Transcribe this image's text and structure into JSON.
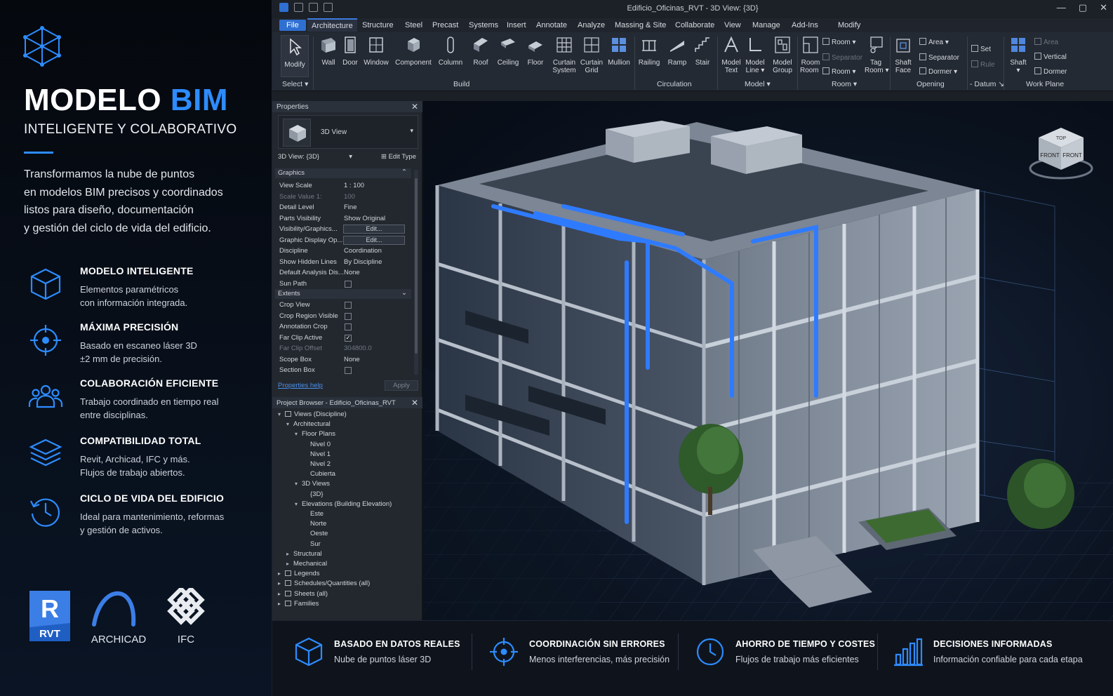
{
  "left": {
    "title_main": "MODELO ",
    "title_accent": "BIM",
    "subtitle": "INTELIGENTE Y COLABORATIVO",
    "intro": [
      "Transformamos la nube de puntos",
      "en modelos BIM precisos y coordinados",
      "listos para diseño, documentación",
      "y gestión del ciclo de vida del edificio."
    ],
    "features": [
      {
        "title": "MODELO INTELIGENTE",
        "desc": [
          "Elementos paramétricos",
          "con información integrada."
        ],
        "icon": "cube-icon"
      },
      {
        "title": "MÁXIMA PRECISIÓN",
        "desc": [
          "Basado en escaneo láser 3D",
          "±2 mm de precisión."
        ],
        "icon": "crosshair-icon"
      },
      {
        "title": "COLABORACIÓN EFICIENTE",
        "desc": [
          "Trabajo coordinado en tiempo real",
          "entre disciplinas."
        ],
        "icon": "users-icon"
      },
      {
        "title": "COMPATIBILIDAD TOTAL",
        "desc": [
          "Revit, Archicad, IFC y más.",
          "Flujos de trabajo abiertos."
        ],
        "icon": "layers-icon"
      },
      {
        "title": "CICLO DE VIDA DEL EDIFICIO",
        "desc": [
          "Ideal para mantenimiento, reformas",
          "y gestión de activos."
        ],
        "icon": "history-clock-icon"
      }
    ],
    "brands": [
      {
        "label": "RVT",
        "letter": "R"
      },
      {
        "label": "ARCHICAD"
      },
      {
        "label": "IFC"
      }
    ]
  },
  "window": {
    "title": "Edificio_Oficinas_RVT - 3D View: {3D}"
  },
  "tabs": [
    "File",
    "Architecture",
    "Structure",
    "Steel",
    "Precast",
    "Systems",
    "Insert",
    "Annotate",
    "Analyze",
    "Massing & Site",
    "Collaborate",
    "View",
    "Manage",
    "Add-Ins",
    "Modify"
  ],
  "ribbon": {
    "buttons": [
      "Modify",
      "Wall",
      "Door",
      "Window",
      "Component",
      "Column",
      "Roof",
      "Ceiling",
      "Floor",
      "Curtain",
      "System",
      "Curtain",
      "Grid",
      "Mullion",
      "Railing",
      "Ramp",
      "Stair",
      "Model",
      "Text",
      "Model",
      "Line",
      "Model",
      "Group",
      "Room",
      "Room",
      "Tag",
      "Room",
      "Shaft",
      "Face",
      "Shaft"
    ],
    "small": {
      "room1": "Room",
      "room_sep": "Separator",
      "room2": "Room",
      "area": "Area",
      "area_sep": "Separator",
      "dormer": "Dormer",
      "set": "Set",
      "rule": "Rule",
      "area_dim": "Area",
      "vertical": "Vertical",
      "dormer2": "Dormer"
    },
    "groups": {
      "select": "Select",
      "build": "Build",
      "circulation": "Circulation",
      "model": "Model",
      "room": "Room",
      "opening": "Opening",
      "datum": "Datum",
      "workplane": "Work Plane"
    }
  },
  "properties": {
    "header": "Properties",
    "type_name": "3D View",
    "instance": "3D View: {3D}",
    "edit_type": "Edit Type",
    "section_graphics": "Graphics",
    "section_extents": "Extents",
    "rows_graphics": [
      {
        "k": "View Scale",
        "v": "1 : 100"
      },
      {
        "k": "Scale Value    1:",
        "v": "100",
        "dim": true
      },
      {
        "k": "Detail Level",
        "v": "Fine"
      },
      {
        "k": "Parts Visibility",
        "v": "Show Original"
      },
      {
        "k": "Visibility/Graphics...",
        "v": "Edit...",
        "btn": true
      },
      {
        "k": "Graphic Display Op...",
        "v": "Edit...",
        "btn": true
      },
      {
        "k": "Discipline",
        "v": "Coordination"
      },
      {
        "k": "Show Hidden Lines",
        "v": "By Discipline"
      },
      {
        "k": "Default Analysis Dis...",
        "v": "None"
      },
      {
        "k": "Sun Path",
        "v": "",
        "chk": false
      }
    ],
    "rows_extents": [
      {
        "k": "Crop View",
        "v": "",
        "chk": false
      },
      {
        "k": "Crop Region Visible",
        "v": "",
        "chk": false
      },
      {
        "k": "Annotation Crop",
        "v": "",
        "chk": false
      },
      {
        "k": "Far Clip Active",
        "v": "",
        "chk": true
      },
      {
        "k": "Far Clip Offset",
        "v": "304800.0",
        "dim": true
      },
      {
        "k": "Scope Box",
        "v": "None"
      },
      {
        "k": "Section Box",
        "v": "",
        "chk": false
      }
    ],
    "help": "Properties help",
    "apply": "Apply"
  },
  "browser": {
    "header": "Project Browser - Edificio_Oficinas_RVT",
    "items": [
      {
        "t": "Views (Discipline)",
        "lvl": 0,
        "tw": "▾",
        "box": true
      },
      {
        "t": "Architectural",
        "lvl": 1,
        "tw": "▾"
      },
      {
        "t": "Floor Plans",
        "lvl": 2,
        "tw": "▾"
      },
      {
        "t": "Nivel 0",
        "lvl": 3
      },
      {
        "t": "Nivel 1",
        "lvl": 3
      },
      {
        "t": "Nivel 2",
        "lvl": 3
      },
      {
        "t": "Cubierta",
        "lvl": 3
      },
      {
        "t": "3D Views",
        "lvl": 2,
        "tw": "▾"
      },
      {
        "t": "{3D}",
        "lvl": 3
      },
      {
        "t": "Elevations (Building Elevation)",
        "lvl": 2,
        "tw": "▾"
      },
      {
        "t": "Este",
        "lvl": 3
      },
      {
        "t": "Norte",
        "lvl": 3
      },
      {
        "t": "Oeste",
        "lvl": 3
      },
      {
        "t": "Sur",
        "lvl": 3
      },
      {
        "t": "Structural",
        "lvl": 1,
        "tw": "▸"
      },
      {
        "t": "Mechanical",
        "lvl": 1,
        "tw": "▸"
      },
      {
        "t": "Legends",
        "lvl": 0,
        "tw": "▸",
        "box": true
      },
      {
        "t": "Schedules/Quantities (all)",
        "lvl": 0,
        "tw": "▸",
        "box": true
      },
      {
        "t": "Sheets (all)",
        "lvl": 0,
        "tw": "▸",
        "box": true
      },
      {
        "t": "Families",
        "lvl": 0,
        "tw": "▸",
        "box": true
      }
    ]
  },
  "viewcube": {
    "front": "FRONT",
    "right": "FRONT",
    "top": "TOP"
  },
  "bottom": [
    {
      "title": "BASADO EN DATOS REALES",
      "desc": "Nube de puntos láser 3D",
      "icon": "cube-icon"
    },
    {
      "title": "COORDINACIÓN SIN ERRORES",
      "desc": "Menos interferencias, más precisión",
      "icon": "crosshair-icon"
    },
    {
      "title": "AHORRO DE TIEMPO Y COSTES",
      "desc": "Flujos de trabajo más eficientes",
      "icon": "clock-icon"
    },
    {
      "title": "DECISIONES INFORMADAS",
      "desc": "Información confiable para cada etapa",
      "icon": "bar-chart-icon"
    }
  ],
  "colors": {
    "accent": "#2d8cff",
    "file_tab": "#2f6fd1",
    "bg": "#0a0f18"
  }
}
